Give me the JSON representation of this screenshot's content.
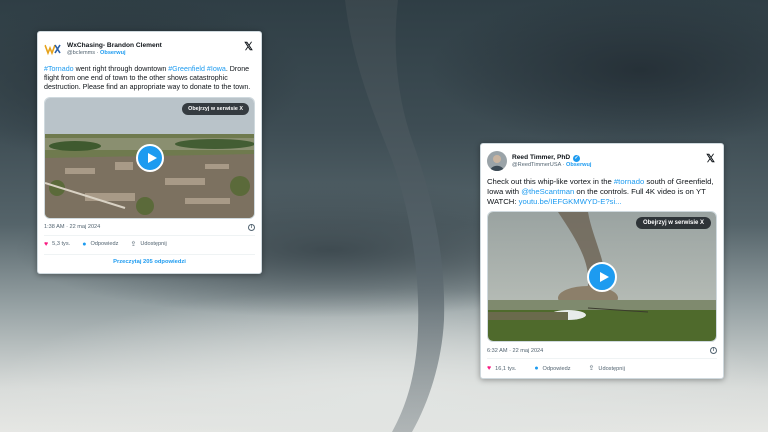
{
  "tweet1": {
    "author_name": "WxChasing- Brandon Clement",
    "handle": "@bclemms",
    "follow_label": "Obserwuj",
    "text_parts": [
      {
        "t": "#Tornado",
        "link": true
      },
      {
        "t": " went right through downtown ",
        "link": false
      },
      {
        "t": "#Greenfield",
        "link": true
      },
      {
        "t": " ",
        "link": false
      },
      {
        "t": "#Iowa",
        "link": true
      },
      {
        "t": ". Drone flight from one end of town to the other shows catastrophic destruction. Please find an appropriate way to donate to the town.",
        "link": false
      }
    ],
    "watch_label": "Obejrzyj w serwisie X",
    "timestamp": "1:38 AM · 22 maj 2024",
    "likes": "5,3 tys.",
    "reply_label": "Odpowiedz",
    "share_label": "Udostępnij",
    "read_replies": "Przeczytaj 205 odpowiedzi"
  },
  "tweet2": {
    "author_name": "Reed Timmer, PhD",
    "handle": "@ReedTimmerUSA",
    "follow_label": "Obserwuj",
    "text_parts": [
      {
        "t": "Check out this whip-like vortex in the ",
        "link": false
      },
      {
        "t": "#tornado",
        "link": true
      },
      {
        "t": " south of Greenfield, Iowa with ",
        "link": false
      },
      {
        "t": "@theScantman",
        "link": true
      },
      {
        "t": " on the controls. Full 4K video is on YT WATCH: ",
        "link": false
      },
      {
        "t": "youtu.be/IEFGKMWYD-E?si...",
        "link": true
      }
    ],
    "watch_label": "Obejrzyj w serwisie X",
    "timestamp": "6:32 AM · 22 maj 2024",
    "likes": "16,1 tys.",
    "reply_label": "Odpowiedz",
    "share_label": "Udostępnij"
  },
  "icons": {
    "x_logo": "x-logo-icon",
    "play": "play-icon",
    "heart": "heart-icon",
    "reply": "reply-bubble-icon",
    "share": "share-icon",
    "info": "info-icon",
    "verified": "verified-badge-icon"
  },
  "colors": {
    "link_blue": "#1d9bf0",
    "heart_pink": "#f91880",
    "text_dark": "#0f1419",
    "text_gray": "#536471"
  }
}
